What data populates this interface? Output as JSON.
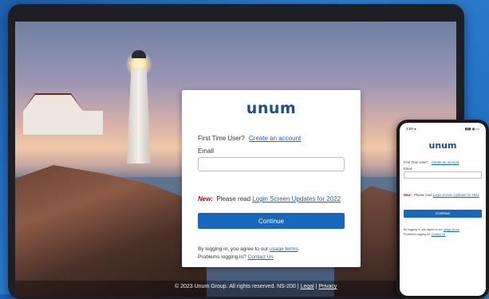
{
  "brand": {
    "logo_text": "unum",
    "color": "#1e4d8f"
  },
  "login": {
    "first_time_text": "First Time User?",
    "create_account_link": "Create an account",
    "email_label": "Email",
    "email_value": "",
    "new_badge": "New:",
    "notice_text": "Please read",
    "notice_link": "Login Screen Updates for 2022",
    "continue_label": "Continue",
    "terms_text": "By logging in, you agree to our",
    "terms_link": "usage terms",
    "terms_end": ".",
    "problems_text": "Problems logging in?",
    "problems_link": "Contact Us"
  },
  "footer": {
    "copyright": "© 2023 Unum Group. All rights reserved. NS-200",
    "separator": "|",
    "legal_link": "Legal",
    "privacy_link": "Privacy"
  },
  "phone": {
    "status_time": "3:59 ◂",
    "status_icons": "▮▮▮ ◉ ▭",
    "logo_text": "unum",
    "first_time_text": "First Time User?",
    "create_account_link": "Create an account",
    "email_label": "Email",
    "new_badge": "New:",
    "notice_text": "Please read",
    "notice_link": "Login Screen Updates for 2022",
    "continue_label": "Continue",
    "terms_text": "By logging in, you agree to our",
    "terms_link": "usage terms",
    "problems_text": "Problems logging in?",
    "problems_link": "Contact Us"
  },
  "colors": {
    "accent": "#1867bd",
    "link": "#1c63c3",
    "new": "#d0021b"
  }
}
